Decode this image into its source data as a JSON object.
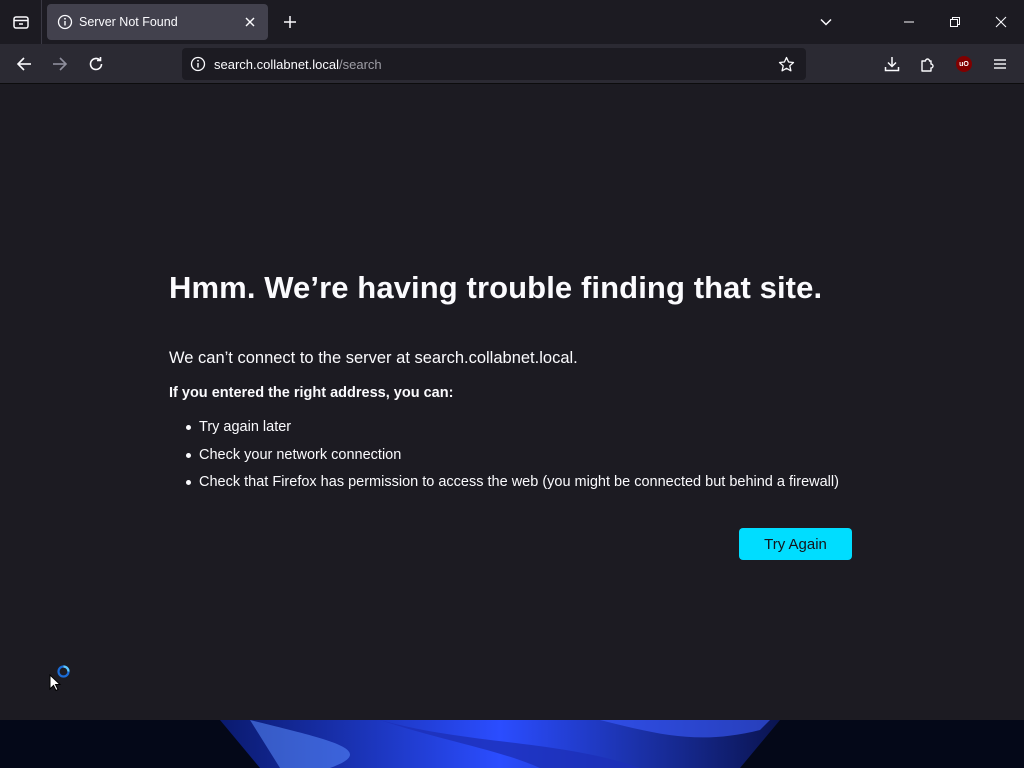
{
  "browser": {
    "tab": {
      "title": "Server Not Found"
    },
    "address": {
      "host": "search.collabnet.local",
      "path": "/search"
    }
  },
  "error": {
    "title": "Hmm. We’re having trouble finding that site.",
    "description": "We can’t connect to the server at search.collabnet.local.",
    "subheading": "If you entered the right address, you can:",
    "suggestions": [
      "Try again later",
      "Check your network connection",
      "Check that Firefox has permission to access the web (you might be connected but behind a firewall)"
    ],
    "button_label": "Try Again"
  },
  "colors": {
    "accent": "#00ddff",
    "page_background": "#1c1b22",
    "toolbar": "#2b2a33",
    "text": "#fbfbfe"
  },
  "icons": {
    "tab_overview": "tab-overview-icon",
    "favicon": "info-icon",
    "tab_close": "close-icon",
    "new_tab": "plus-icon",
    "tab_list": "chevron-down-icon",
    "back": "back-arrow-icon",
    "forward": "forward-arrow-icon",
    "reload": "reload-icon",
    "site_info": "info-icon",
    "bookmark": "star-icon",
    "downloads": "download-icon",
    "extensions": "puzzle-icon",
    "ublock": "ublock-icon",
    "menu": "hamburger-menu-icon"
  }
}
